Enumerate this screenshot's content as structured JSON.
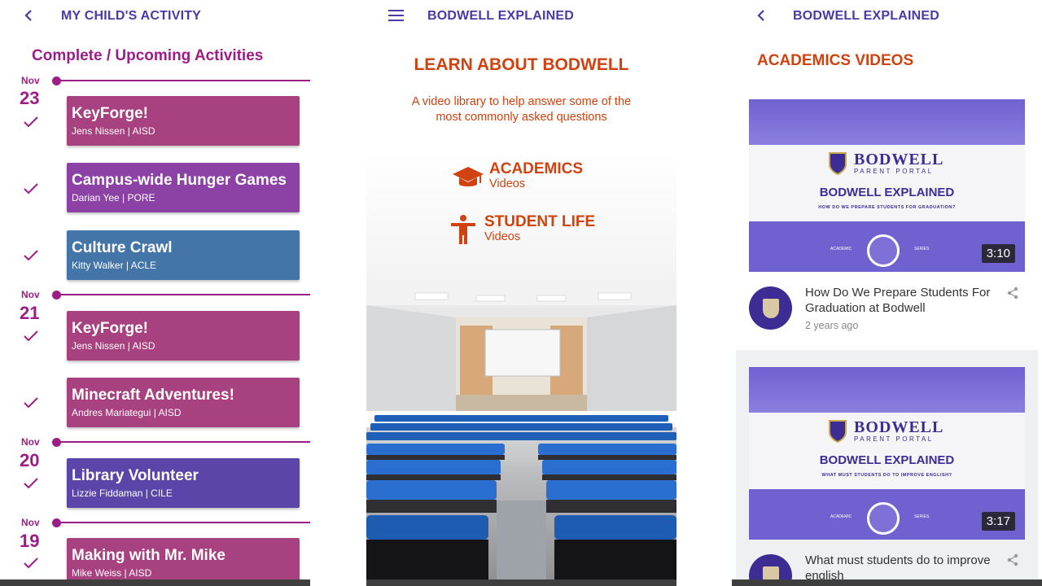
{
  "screen1": {
    "title": "MY CHILD'S ACTIVITY",
    "section_title": "Complete / Upcoming Activities",
    "dates": [
      {
        "month": "Nov",
        "day": "23"
      },
      {
        "month": "Nov",
        "day": "21"
      },
      {
        "month": "Nov",
        "day": "20"
      },
      {
        "month": "Nov",
        "day": "19"
      }
    ],
    "activities": [
      {
        "title": "KeyForge!",
        "subtitle": "Jens Nissen | AISD",
        "color": "#a8417f"
      },
      {
        "title": "Campus-wide Hunger Games",
        "subtitle": "Darian Yee | PORE",
        "color": "#8c42a5"
      },
      {
        "title": "Culture Crawl",
        "subtitle": "Kitty Walker | ACLE",
        "color": "#4475a8"
      },
      {
        "title": "KeyForge!",
        "subtitle": "Jens Nissen | AISD",
        "color": "#a8417f"
      },
      {
        "title": "Minecraft Adventures!",
        "subtitle": "Andres Mariategui | AISD",
        "color": "#a8417f"
      },
      {
        "title": "Library Volunteer",
        "subtitle": "Lizzie Fiddaman | CILE",
        "color": "#5b45a8"
      },
      {
        "title": "Making with Mr. Mike",
        "subtitle": "Mike Weiss | AISD",
        "color": "#a8417f"
      }
    ]
  },
  "screen2": {
    "title": "BODWELL EXPLAINED",
    "heading": "LEARN ABOUT BODWELL",
    "intro": "A video library to help answer some of the most commonly asked questions",
    "options": [
      {
        "title": "ACADEMICS",
        "subtitle": "Videos",
        "icon": "graduation-cap-icon"
      },
      {
        "title": "STUDENT LIFE",
        "subtitle": "Videos",
        "icon": "person-icon"
      }
    ]
  },
  "screen3": {
    "title": "BODWELL EXPLAINED",
    "heading": "ACADEMICS VIDEOS",
    "thumb_brand": "BODWELL",
    "thumb_sub": "PARENT PORTAL",
    "thumb_explained": "BODWELL EXPLAINED",
    "thumb_series_left": "ACADEMIC",
    "thumb_series_right": "SERIES",
    "videos": [
      {
        "duration": "3:10",
        "thumb_question": "HOW DO WE PREPARE STUDENTS FOR GRADUATION?",
        "title": "How Do We Prepare Students For Graduation at Bodwell",
        "age": "2 years ago"
      },
      {
        "duration": "3:17",
        "thumb_question": "WHAT MUST STUDENTS DO TO IMPROVE ENGLISH?",
        "title": "What must students do to improve english",
        "age": ""
      }
    ]
  }
}
